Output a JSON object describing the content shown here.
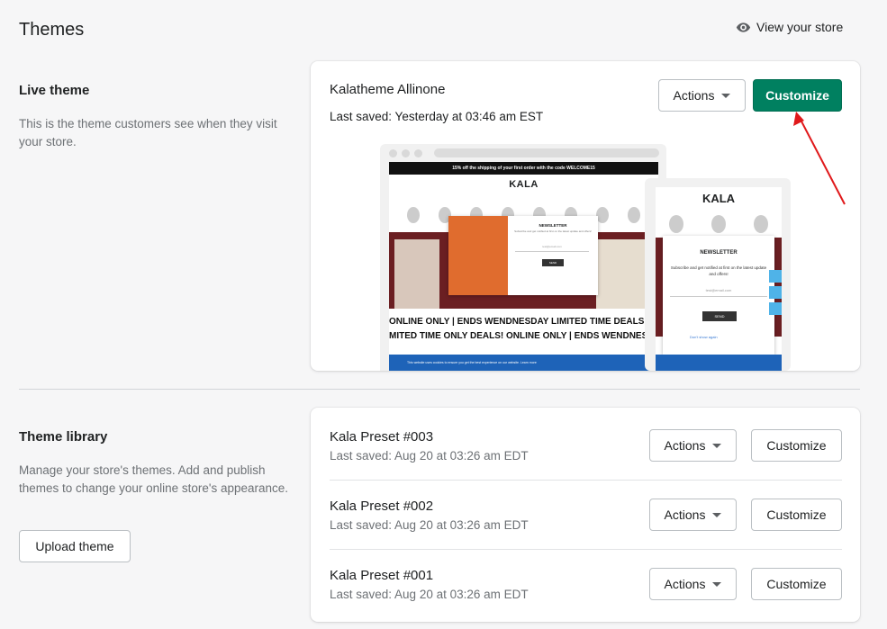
{
  "header": {
    "title": "Themes",
    "view_store_label": "View your store"
  },
  "live_theme": {
    "section_title": "Live theme",
    "section_desc": "This is the theme customers see when they visit your store.",
    "name": "Kalatheme Allinone",
    "last_saved": "Last saved: Yesterday at 03:46 am EST",
    "actions_label": "Actions",
    "customize_label": "Customize",
    "preview": {
      "promo_text": "15% off the shipping of your first order with the code WELCOME15",
      "logo": "KALA",
      "popup_title": "NEWSLETTER",
      "popup_subtitle": "Subscribe and get notified at first on the latest update and offers!",
      "popup_email_placeholder": "test@email.com",
      "popup_send": "SEND",
      "popup_checkbox": "Don't show again",
      "marquee_1": "ONLINE ONLY | ENDS WENDNESDAY LIMITED TIME DEALS",
      "marquee_2": "MITED TIME ONLY DEALS! ONLINE ONLY | ENDS WENDNES",
      "cookie_text": "This website uses cookies to ensure you get the best experience on our website. Learn more"
    }
  },
  "library": {
    "section_title": "Theme library",
    "section_desc": "Manage your store's themes. Add and publish themes to change your online store's appearance.",
    "upload_label": "Upload theme",
    "themes": [
      {
        "name": "Kala Preset #003",
        "last_saved": "Last saved: Aug 20 at 03:26 am EDT",
        "actions_label": "Actions",
        "customize_label": "Customize"
      },
      {
        "name": "Kala Preset #002",
        "last_saved": "Last saved: Aug 20 at 03:26 am EDT",
        "actions_label": "Actions",
        "customize_label": "Customize"
      },
      {
        "name": "Kala Preset #001",
        "last_saved": "Last saved: Aug 20 at 03:26 am EDT",
        "actions_label": "Actions",
        "customize_label": "Customize"
      }
    ]
  },
  "colors": {
    "primary": "#008060",
    "annotation_arrow": "#e0191b"
  }
}
